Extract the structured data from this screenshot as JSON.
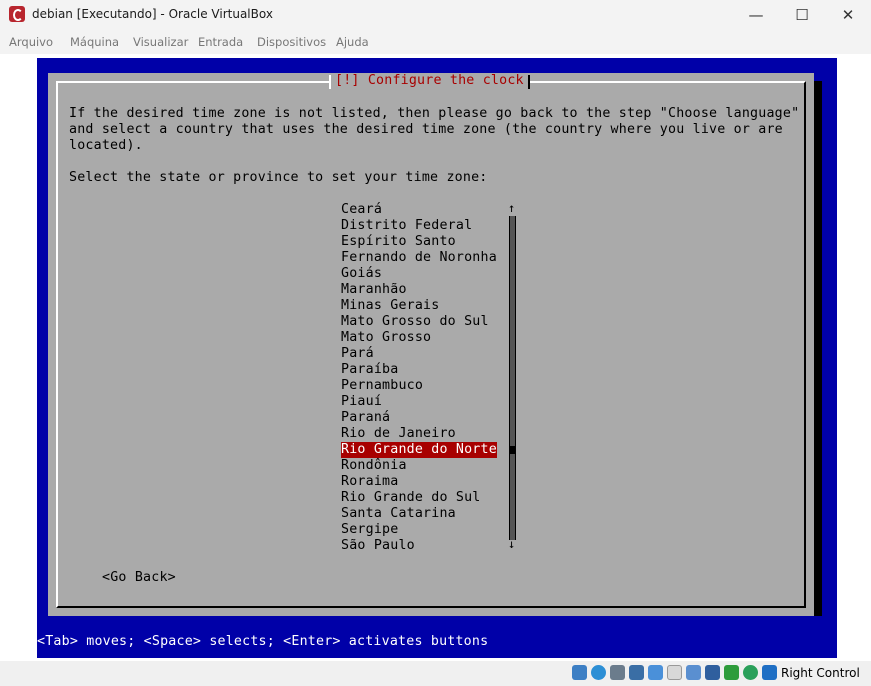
{
  "window": {
    "title": "debian [Executando] - Oracle VirtualBox",
    "minimize_icon": "—",
    "maximize_icon": "☐",
    "close_icon": "✕"
  },
  "menubar": {
    "items": [
      "Arquivo",
      "Máquina",
      "Visualizar",
      "Entrada",
      "Dispositivos",
      "Ajuda"
    ]
  },
  "installer": {
    "dialog_title": "[!] Configure the clock",
    "intro_lines": [
      "If the desired time zone is not listed, then please go back to the step \"Choose language\"",
      "and select a country that uses the desired time zone (the country where you live or are",
      "located)."
    ],
    "prompt": "Select the state or province to set your time zone:",
    "options": [
      "Ceará",
      "Distrito Federal",
      "Espírito Santo",
      "Fernando de Noronha",
      "Goiás",
      "Maranhão",
      "Minas Gerais",
      "Mato Grosso do Sul",
      "Mato Grosso",
      "Pará",
      "Paraíba",
      "Pernambuco",
      "Piauí",
      "Paraná",
      "Rio de Janeiro",
      "Rio Grande do Norte",
      "Rondônia",
      "Roraima",
      "Rio Grande do Sul",
      "Santa Catarina",
      "Sergipe",
      "São Paulo"
    ],
    "selected_option": "Rio Grande do Norte",
    "scroll_up_arrow": "↑",
    "scroll_down_arrow": "↓",
    "go_back_label": "<Go Back>",
    "help_text": "<Tab> moves; <Space> selects; <Enter> activates buttons"
  },
  "statusbar": {
    "host_key_label": "Right Control",
    "icons": [
      "hard-disk-icon",
      "optical-drive-icon",
      "audio-icon",
      "network-icon",
      "usb-icon",
      "shared-folders-icon",
      "display-icon",
      "recording-icon",
      "mouse-integration-icon",
      "keyboard-capture-icon"
    ]
  },
  "colors": {
    "screen_blue": "#0000a8",
    "dialog_gray": "#aaaaaa",
    "title_red": "#a80000",
    "selection_red": "#a80000"
  }
}
